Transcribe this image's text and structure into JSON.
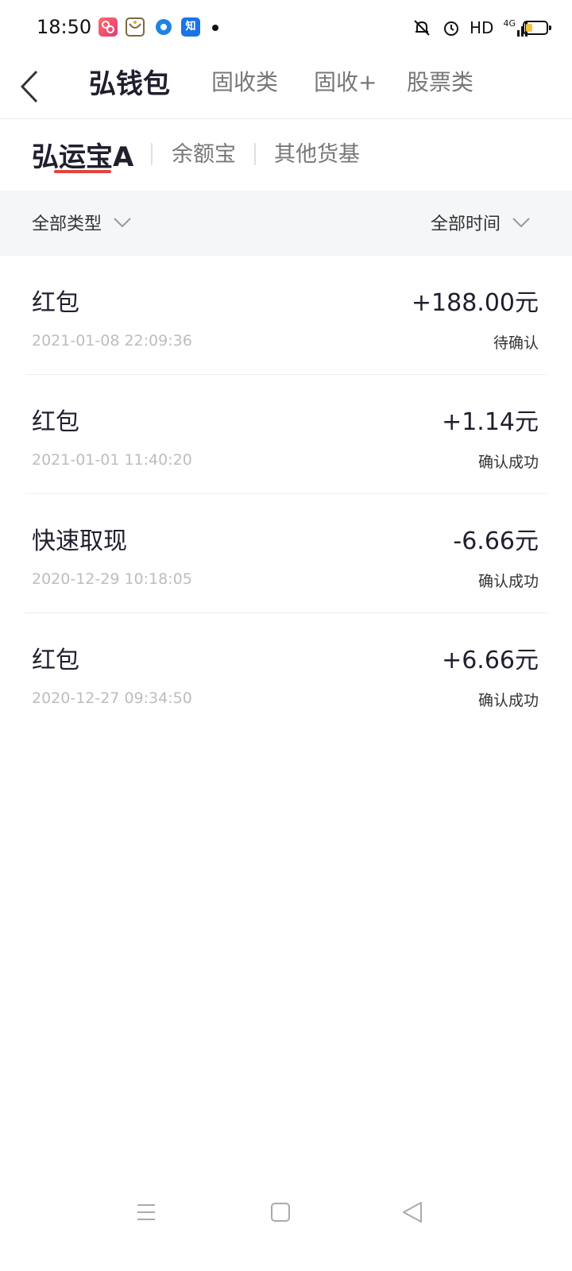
{
  "status_bar": {
    "time": "18:50",
    "app_icons": [
      "app-icon-pink",
      "app-icon-olive",
      "app-icon-blue-circle",
      "zhihu-app-icon"
    ],
    "zhihu_label": "知",
    "hd_label": "HD",
    "network_label": "4G",
    "battery_color": "#f4c542"
  },
  "header": {
    "back_icon": "chevron-left-icon",
    "tabs": [
      {
        "label": "弘钱包",
        "active": true
      },
      {
        "label": "固收类",
        "active": false
      },
      {
        "label": "固收+",
        "active": false
      },
      {
        "label": "股票类",
        "active": false
      }
    ]
  },
  "subtabs": {
    "items": [
      {
        "label": "弘运宝A",
        "active": true
      },
      {
        "label": "余额宝",
        "active": false
      },
      {
        "label": "其他货基",
        "active": false
      }
    ],
    "underline_color": "#e0463d"
  },
  "filters": {
    "type_label": "全部类型",
    "time_label": "全部时间",
    "dropdown_icon": "chevron-down-icon"
  },
  "transactions": [
    {
      "title": "红包",
      "amount": "+188.00元",
      "time": "2021-01-08 22:09:36",
      "status": "待确认"
    },
    {
      "title": "红包",
      "amount": "+1.14元",
      "time": "2021-01-01 11:40:20",
      "status": "确认成功"
    },
    {
      "title": "快速取现",
      "amount": "-6.66元",
      "time": "2020-12-29 10:18:05",
      "status": "确认成功"
    },
    {
      "title": "红包",
      "amount": "+6.66元",
      "time": "2020-12-27 09:34:50",
      "status": "确认成功"
    }
  ],
  "system_nav": {
    "buttons": [
      "menu-icon",
      "home-icon",
      "back-triangle-icon"
    ]
  }
}
